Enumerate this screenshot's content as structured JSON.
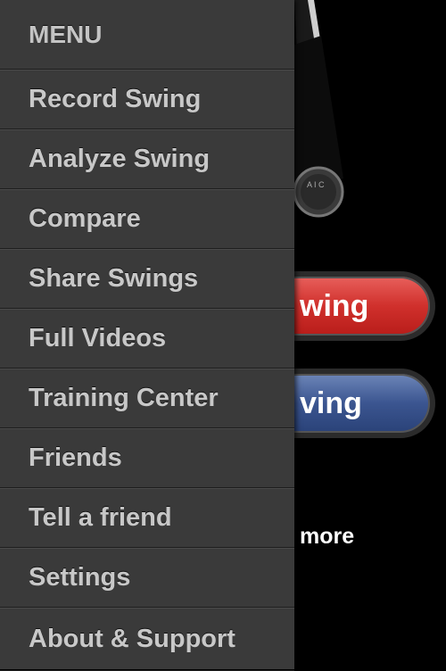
{
  "background": {
    "red_button_label": "wing",
    "blue_button_label": "ving",
    "more_text": "more",
    "bag_badge_text": "A I C"
  },
  "menu": {
    "header": "MENU",
    "items": [
      {
        "label": "Record Swing"
      },
      {
        "label": "Analyze Swing"
      },
      {
        "label": "Compare"
      },
      {
        "label": "Share Swings"
      },
      {
        "label": "Full Videos"
      },
      {
        "label": "Training Center"
      },
      {
        "label": "Friends"
      },
      {
        "label": "Tell a friend"
      },
      {
        "label": "Settings"
      },
      {
        "label": "About & Support"
      }
    ]
  },
  "colors": {
    "menu_bg": "#3a3a3a",
    "menu_text": "#c8c8c8",
    "red_button": "#c8302c",
    "blue_button": "#3b5590"
  }
}
